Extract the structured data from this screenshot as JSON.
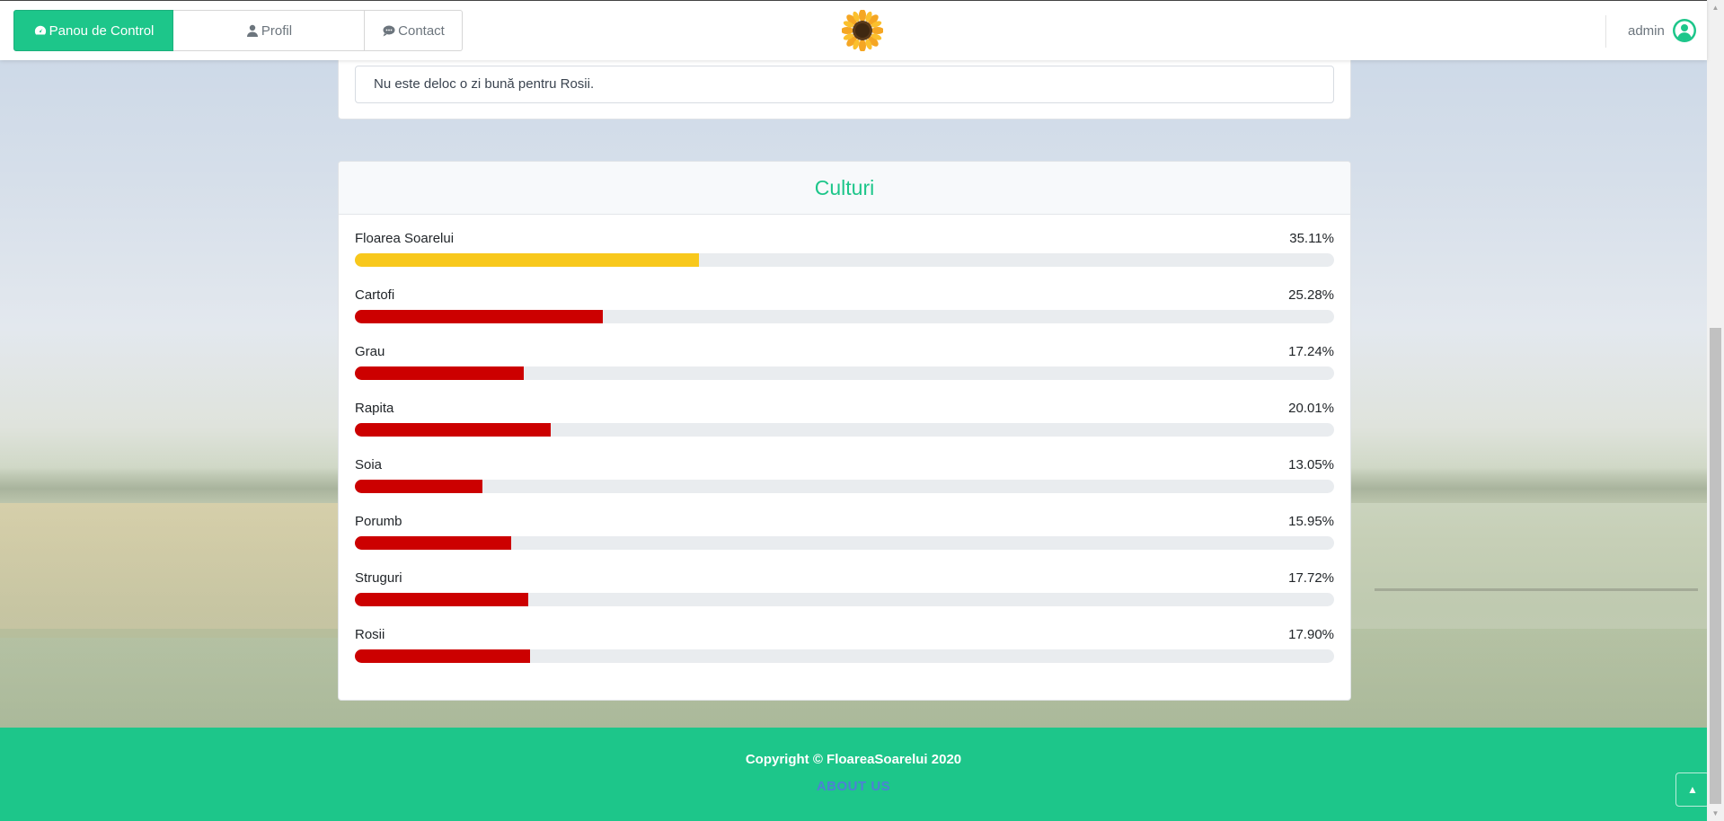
{
  "nav": {
    "tabs": [
      {
        "label": "Panou de Control",
        "icon": "dashboard-icon",
        "active": true
      },
      {
        "label": "Profil",
        "icon": "user-icon",
        "active": false
      },
      {
        "label": "Contact",
        "icon": "chat-icon",
        "active": false
      }
    ],
    "logo": "sunflower-logo",
    "user": {
      "name": "admin",
      "icon": "user-circle-icon"
    }
  },
  "alert": {
    "text": "Nu este deloc o zi bună pentru Rosii."
  },
  "crops_card": {
    "title": "Culturi",
    "items": [
      {
        "name": "Floarea Soarelui",
        "percent_label": "35.11%",
        "value": 35.11,
        "color": "#f8c81c"
      },
      {
        "name": "Cartofi",
        "percent_label": "25.28%",
        "value": 25.28,
        "color": "#cc0000"
      },
      {
        "name": "Grau",
        "percent_label": "17.24%",
        "value": 17.24,
        "color": "#cc0000"
      },
      {
        "name": "Rapita",
        "percent_label": "20.01%",
        "value": 20.01,
        "color": "#cc0000"
      },
      {
        "name": "Soia",
        "percent_label": "13.05%",
        "value": 13.05,
        "color": "#cc0000"
      },
      {
        "name": "Porumb",
        "percent_label": "15.95%",
        "value": 15.95,
        "color": "#cc0000"
      },
      {
        "name": "Struguri",
        "percent_label": "17.72%",
        "value": 17.72,
        "color": "#cc0000"
      },
      {
        "name": "Rosii",
        "percent_label": "17.90%",
        "value": 17.9,
        "color": "#cc0000"
      }
    ]
  },
  "footer": {
    "copyright": "Copyright © FloareaSoarelui 2020",
    "about_link": "ABOUT US"
  },
  "colors": {
    "accent": "#1dc68a",
    "bar_low": "#cc0000",
    "bar_high": "#f8c81c"
  }
}
